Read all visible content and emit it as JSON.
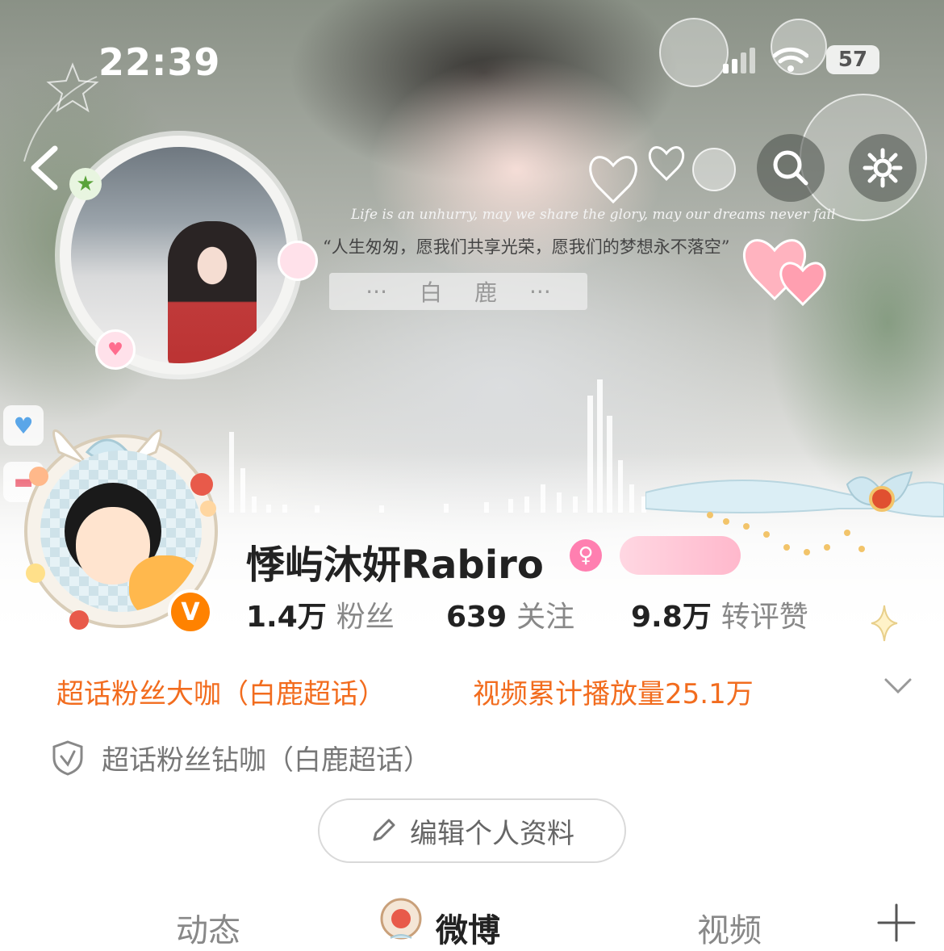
{
  "status_bar": {
    "time": "22:39",
    "battery": "57"
  },
  "header": {
    "quote_en": "Life is an unhurry, may we share the glory, may our dreams never fail",
    "quote_cn": "“人生匆匆，愿我们共享光荣，愿我们的梦想永不落空”",
    "plate_left": "···",
    "plate_name_1": "白",
    "plate_name_2": "鹿",
    "plate_right": "···"
  },
  "profile": {
    "username": "悸屿沐妍Rabiro",
    "gender_icon": "female-icon",
    "verified_mark": "V",
    "followers_num": "1.4万",
    "followers_label": "粉丝",
    "following_num": "639",
    "following_label": "关注",
    "likes_num": "9.8万",
    "likes_label": "转评赞"
  },
  "tags": {
    "tag1": "超话粉丝大咖（白鹿超话）",
    "tag2": "视频累计播放量25.1万",
    "shield_text": "超话粉丝钻咖（白鹿超话）"
  },
  "actions": {
    "edit_profile": "编辑个人资料"
  },
  "tabs": [
    {
      "label": "动态"
    },
    {
      "label": "微博"
    },
    {
      "label": "视频"
    }
  ],
  "colors": {
    "accent_orange": "#f26c1e",
    "verified_orange": "#ff8200",
    "gender_pink": "#ff7fb0"
  }
}
